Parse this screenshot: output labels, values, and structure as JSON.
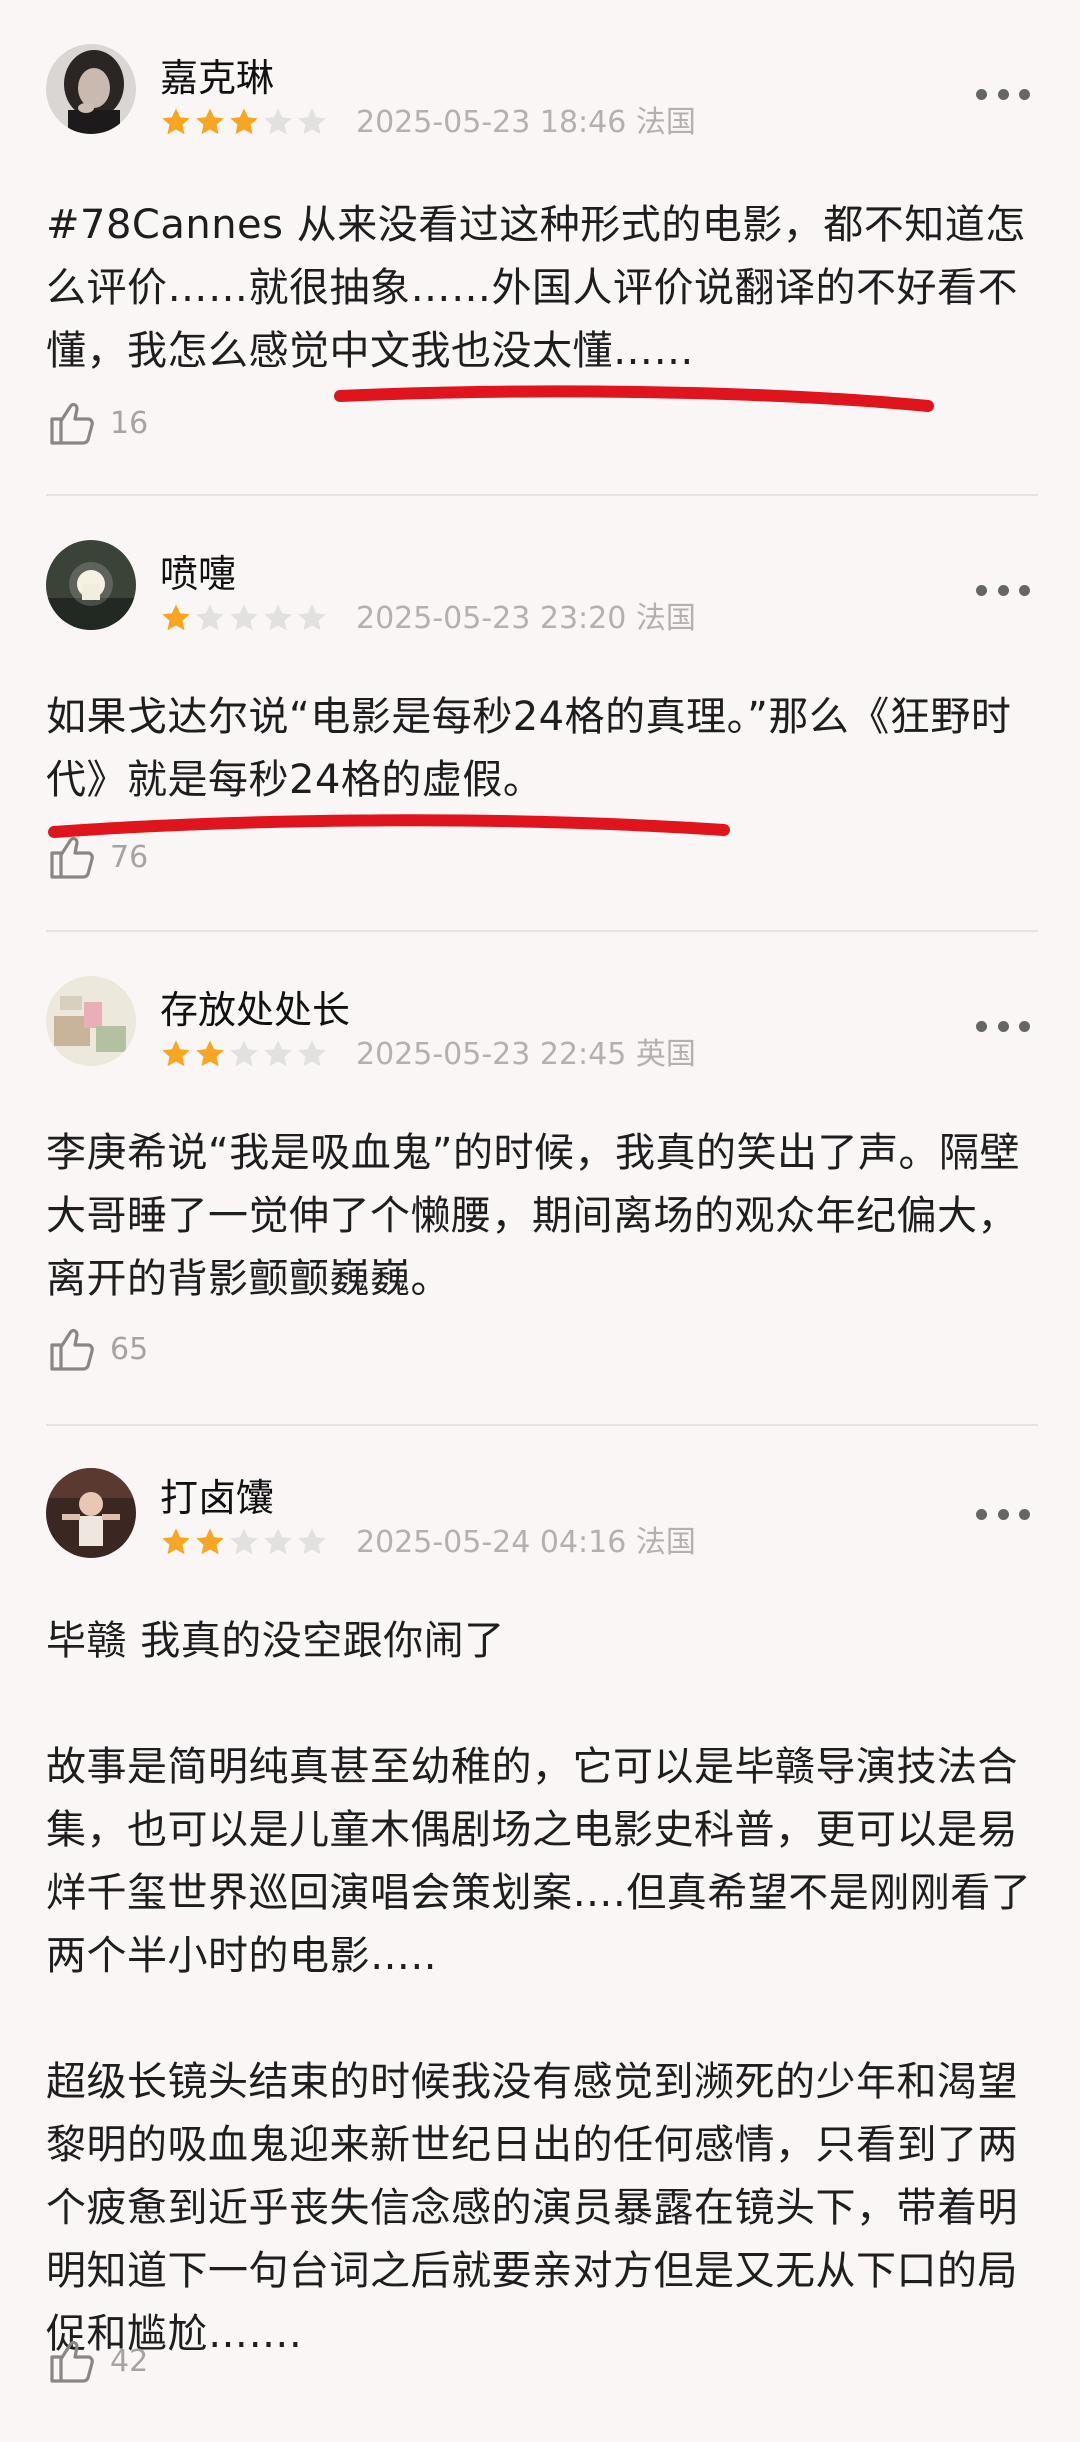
{
  "reviews": [
    {
      "username": "嘉克琳",
      "rating": 3,
      "date": "2025-05-23 18:46",
      "location": "法国",
      "paragraphs": [
        "#78Cannes 从来没看过这种形式的电影，都不知道怎么评价……就很抽象……外国人评价说翻译的不好看不懂，我怎么感觉中文我也没太懂……"
      ],
      "likes": "16"
    },
    {
      "username": "喷嚏",
      "rating": 1,
      "date": "2025-05-23 23:20",
      "location": "法国",
      "paragraphs": [
        "如果戈达尔说“电影是每秒24格的真理。”那么《狂野时代》就是每秒24格的虚假。"
      ],
      "likes": "76"
    },
    {
      "username": "存放处处长",
      "rating": 2,
      "date": "2025-05-23 22:45",
      "location": "英国",
      "paragraphs": [
        "李庚希说“我是吸血鬼”的时候，我真的笑出了声。隔壁大哥睡了一觉伸了个懒腰，期间离场的观众年纪偏大，离开的背影颤颤巍巍。"
      ],
      "likes": "65"
    },
    {
      "username": "打卤馕",
      "rating": 2,
      "date": "2025-05-24 04:16",
      "location": "法国",
      "paragraphs": [
        "毕赣 我真的没空跟你闹了",
        "故事是简明纯真甚至幼稚的，它可以是毕赣导演技法合集，也可以是儿童木偶剧场之电影史科普，更可以是易烊千玺世界巡回演唱会策划案….但真希望不是刚刚看了两个半小时的电影…..",
        "超级长镜头结束的时候我没有感觉到濒死的少年和渴望黎明的吸血鬼迎来新世纪日出的任何感情，只看到了两个疲惫到近乎丧失信念感的演员暴露在镜头下，带着明明知道下一句台词之后就要亲对方但是又无从下口的局促和尴尬……."
      ],
      "likes": "42"
    }
  ],
  "colors": {
    "background": "#faf6f6",
    "star_filled": "#f6a623",
    "star_empty": "#e3e0e0",
    "annotation_red": "#e0141c",
    "meta_gray": "#b4b0b0"
  },
  "icons": {
    "like": "thumbs-up-icon",
    "more": "more-dots-icon",
    "star": "star-icon"
  }
}
